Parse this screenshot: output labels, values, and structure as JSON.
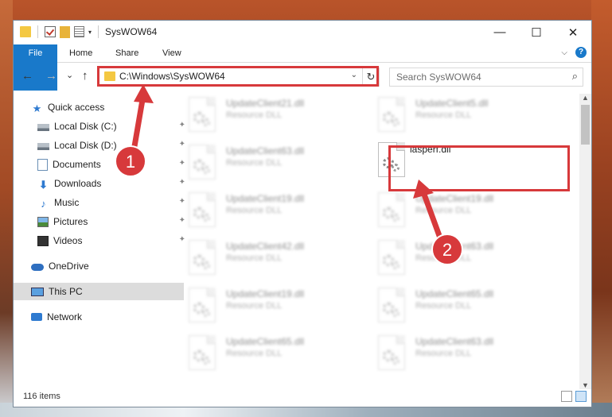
{
  "window": {
    "title": "SysWOW64",
    "minimize_glyph": "—",
    "maximize_glyph": "☐",
    "close_glyph": "✕"
  },
  "ribbon": {
    "tabs": [
      "File",
      "Home",
      "Share",
      "View"
    ],
    "help_glyph": "?",
    "collapse_glyph": "⌵"
  },
  "nav": {
    "back_glyph": "←",
    "forward_glyph": "→",
    "recent_glyph": "⌄",
    "up_glyph": "↑",
    "address": "C:\\Windows\\SysWOW64",
    "address_dropdown_glyph": "⌄",
    "refresh_glyph": "↻",
    "search_placeholder": "Search SysWOW64",
    "search_glyph": "⌕"
  },
  "sidebar": {
    "quick_access": "Quick access",
    "pinned": [
      {
        "label": "Local Disk (C:)",
        "icon": "disk-icon"
      },
      {
        "label": "Local Disk (D:)",
        "icon": "disk-icon"
      },
      {
        "label": "Documents",
        "icon": "documents-icon"
      },
      {
        "label": "Downloads",
        "icon": "downloads-icon"
      },
      {
        "label": "Music",
        "icon": "music-icon"
      },
      {
        "label": "Pictures",
        "icon": "pictures-icon"
      },
      {
        "label": "Videos",
        "icon": "videos-icon"
      }
    ],
    "pin_glyph": "📌",
    "onedrive": "OneDrive",
    "this_pc": "This PC",
    "network": "Network"
  },
  "files": {
    "left_column": [
      {
        "name": "UpdateClient21.dll",
        "type": "Resource DLL"
      },
      {
        "name": "UpdateClient63.dll",
        "type": "Resource DLL"
      },
      {
        "name": "UpdateClient19.dll",
        "type": "Resource DLL"
      },
      {
        "name": "UpdateClient42.dll",
        "type": "Resource DLL"
      },
      {
        "name": "UpdateClient19.dll",
        "type": "Resource DLL"
      },
      {
        "name": "UpdateClient65.dll",
        "type": "Resource DLL"
      }
    ],
    "right_column": [
      {
        "name": "UpdateClient5.dll",
        "type": "Resource DLL"
      },
      {
        "name": "iasperf.dll",
        "type": ""
      },
      {
        "name": "UpdateClient19.dll",
        "type": "Resource DLL"
      },
      {
        "name": "UpdateClient63.dll",
        "type": "Resource DLL"
      },
      {
        "name": "UpdateClient65.dll",
        "type": "Resource DLL"
      },
      {
        "name": "UpdateClient63.dll",
        "type": "Resource DLL"
      }
    ],
    "highlighted_index": 1
  },
  "status": {
    "item_count": "116 items"
  },
  "callouts": [
    {
      "number": "1",
      "color": "#d7393b"
    },
    {
      "number": "2",
      "color": "#d7393b"
    }
  ],
  "scroll": {
    "up_glyph": "▲",
    "down_glyph": "▼"
  }
}
